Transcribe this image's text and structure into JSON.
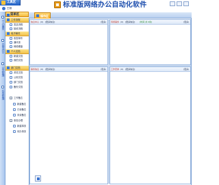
{
  "header": {
    "app_badge": "工具区",
    "user_label": "王勤",
    "system_title": "标准版网络办公自动化软件",
    "window_buttons": [
      "minimize",
      "restore",
      "close"
    ]
  },
  "sidebar": {
    "vertical_tabs": [
      "个人事务",
      "日常办公",
      "公文管理",
      "任务管理"
    ],
    "menu_header": "菜单区",
    "groups": [
      {
        "label": "工作流程",
        "items": [
          "发送流程",
          "接收流程"
        ]
      },
      {
        "label": "电子邮件",
        "items": [
          "收发邮件",
          "通讯录",
          "网络硬盘"
        ]
      },
      {
        "label": "个人文档",
        "items": [
          "新建文档",
          "我的文档"
        ]
      },
      {
        "label": "部门文档",
        "items": [
          "浏览文档",
          "公用文档",
          "部门文档",
          "备份文档"
        ]
      },
      {
        "label": "工作备忘",
        "items": [
          "新建备忘",
          "已读备忘",
          "未读备忘"
        ]
      },
      {
        "label": "事务办理",
        "items": [
          "新建事务",
          "待办事务"
        ]
      }
    ]
  },
  "main": {
    "active_tab": "操作区",
    "panels": [
      {
        "title": "信息中心",
        "count": "(0)",
        "sub": "[更多信息]",
        "right": "[更多]"
      },
      {
        "title": "待阅事务",
        "count": "(0)",
        "sub": "[更多信息]",
        "extra": "[时间 共 0条]",
        "right": "[更多]"
      },
      {
        "title": "事务信息",
        "count": "(0)",
        "sub": "[更多信息]",
        "right": "[更多]"
      },
      {
        "title": "工作安排",
        "count": "(0)",
        "sub": "[更多信息]",
        "right": "[更多]"
      }
    ]
  }
}
